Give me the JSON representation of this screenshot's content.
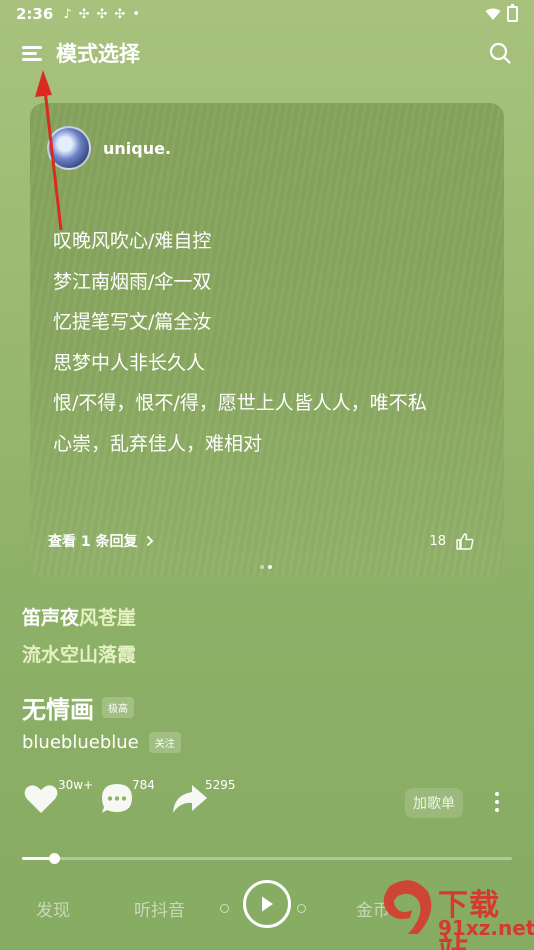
{
  "status_bar": {
    "time": "2:36",
    "notification_icons": [
      "music-note-icon",
      "pinwheel-icon",
      "pinwheel-icon",
      "pinwheel-icon",
      "dot-icon"
    ],
    "right_icons": [
      "wifi-icon",
      "battery-icon"
    ]
  },
  "header": {
    "title": "模式选择",
    "menu_icon": "menu-icon",
    "search_icon": "search-icon"
  },
  "comment_card": {
    "username": "unique.",
    "lyrics": [
      "叹晚风吹心/难自控",
      "梦江南烟雨/伞一双",
      "忆提笔写文/篇全汝",
      "思梦中人非长久人",
      "恨/不得，恨不/得，愿世上人皆人人，唯不私",
      "心崇，乱弃佳人，难相对"
    ],
    "reply_label": "查看 1 条回复",
    "like_count": "18",
    "pager_total": 2,
    "pager_active": 2
  },
  "current_lyric": {
    "sung": "笛声夜",
    "unsung": "风苍崖"
  },
  "next_lyric": "流水空山落霞",
  "song": {
    "title": "无情画",
    "quality": "极高",
    "artist": "blueblueblue",
    "follow_label": "关注"
  },
  "actions": {
    "like_count": "30w+",
    "comment_count": "784",
    "share_count": "5295",
    "playlist_label": "加歌单"
  },
  "progress": {
    "fraction": 0.065
  },
  "bottom_nav": {
    "items": [
      "发现",
      "听抖音",
      "金币"
    ]
  },
  "watermark": {
    "brand": "下载站",
    "domain": "91xz.net",
    "logo_text": "9"
  },
  "colors": {
    "background": "#9ab96f",
    "lyric_unsung": "#e5f1c3",
    "annotation_arrow": "#d92b20",
    "watermark": "#d63a2e"
  }
}
